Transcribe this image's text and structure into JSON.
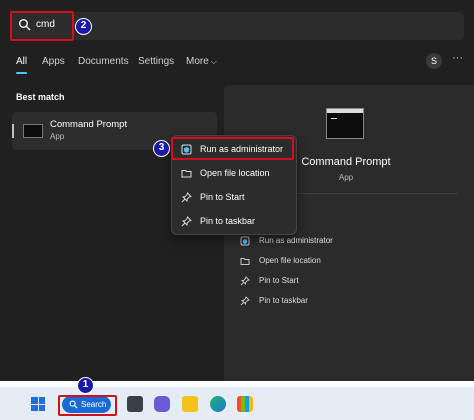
{
  "search": {
    "query": "cmd",
    "icon": "search-icon"
  },
  "badges": {
    "step1": "1",
    "step2": "2",
    "step3": "3"
  },
  "tabs": [
    {
      "label": "All",
      "active": true
    },
    {
      "label": "Apps"
    },
    {
      "label": "Documents"
    },
    {
      "label": "Settings"
    },
    {
      "label": "More"
    }
  ],
  "user": {
    "initial": "S",
    "more_options": "···"
  },
  "results": {
    "section_label": "Best match",
    "best_match": {
      "title": "Command Prompt",
      "subtitle": "App"
    }
  },
  "details": {
    "title": "Command Prompt",
    "subtitle": "App",
    "actions": [
      {
        "label": "Run as administrator",
        "icon": "shield-icon"
      },
      {
        "label": "Open file location",
        "icon": "folder-icon"
      },
      {
        "label": "Pin to Start",
        "icon": "pin-icon"
      },
      {
        "label": "Pin to taskbar",
        "icon": "pin-icon"
      }
    ]
  },
  "context_menu": {
    "items": [
      {
        "label": "Run as administrator",
        "icon": "shield-icon"
      },
      {
        "label": "Open file location",
        "icon": "folder-icon"
      },
      {
        "label": "Pin to Start",
        "icon": "pin-icon"
      },
      {
        "label": "Pin to taskbar",
        "icon": "pin-icon"
      }
    ]
  },
  "taskbar": {
    "search_label": "Search",
    "icons": [
      "windows-start-icon",
      "task-view-icon",
      "teams-icon",
      "file-explorer-icon",
      "edge-icon",
      "store-icon"
    ]
  },
  "colors": {
    "highlight": "#d10f1f",
    "badge": "#1a1aa6",
    "accent": "#4cc2ff",
    "taskbar_search": "#1a6ad6"
  }
}
